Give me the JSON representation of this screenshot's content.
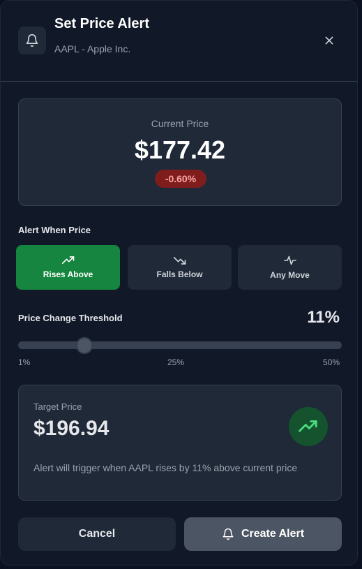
{
  "header": {
    "title": "Set Price Alert",
    "subtitle": "AAPL - Apple Inc.",
    "icon": "bell-icon",
    "close_icon": "close-icon"
  },
  "current_price": {
    "label": "Current Price",
    "value": "$177.42",
    "change": "-0.60%"
  },
  "alert_when": {
    "label": "Alert When Price",
    "options": [
      {
        "label": "Rises Above",
        "icon": "trending-up-icon",
        "selected": true
      },
      {
        "label": "Falls Below",
        "icon": "trending-down-icon",
        "selected": false
      },
      {
        "label": "Any Move",
        "icon": "activity-icon",
        "selected": false
      }
    ]
  },
  "threshold": {
    "label": "Price Change Threshold",
    "value_text": "11%",
    "min_label": "1%",
    "mid_label": "25%",
    "max_label": "50%",
    "min": 1,
    "max": 50,
    "value": 11
  },
  "target": {
    "label": "Target Price",
    "value": "$196.94",
    "description": "Alert will trigger when AAPL rises by 11% above current price",
    "icon": "trending-up-icon"
  },
  "actions": {
    "cancel_label": "Cancel",
    "create_label": "Create Alert",
    "create_icon": "bell-icon"
  },
  "colors": {
    "accent_green": "#16853f",
    "negative_red": "#7f1d1d",
    "background": "#111827",
    "card": "#1f2937"
  }
}
